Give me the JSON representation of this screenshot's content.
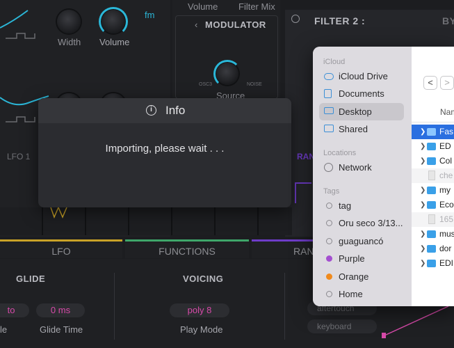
{
  "synth": {
    "fm_badge": "fm",
    "osc_labels": {
      "width": "Width",
      "volume": "Volume"
    },
    "top_labels": {
      "volume": "Volume",
      "filter_mix": "Filter Mix"
    },
    "modulator": {
      "title": "MODULATOR",
      "left": "OSC3",
      "right": "NOISE",
      "source": "Source"
    },
    "filter2": {
      "title": "FILTER 2 :",
      "bypass": "BYP"
    },
    "lfo1": "LFO 1",
    "ran_short": "RAN",
    "tabs": [
      "LFO",
      "FUNCTIONS",
      "RAN"
    ],
    "glide": {
      "title": "GLIDE",
      "mode_value": "to",
      "mode_label": "le",
      "time_value": "0 ms",
      "time_label": "Glide Time"
    },
    "voicing": {
      "title": "VOICING",
      "mode_value": "poly 8",
      "mode_label": "Play Mode"
    },
    "mod_sources": [
      "aftertouch",
      "keyboard"
    ],
    "colors": {
      "accent": "#2bb7d8",
      "pink": "#d74aa9",
      "lfo": "#c9a227",
      "functions": "#3fa66a",
      "ran": "#6e3cc8"
    }
  },
  "dialog": {
    "title": "Info",
    "icon": "info-icon",
    "message": "Importing, please wait . . ."
  },
  "finder": {
    "sidebar": {
      "icloud_header": "iCloud",
      "icloud_items": [
        {
          "label": "iCloud Drive",
          "icon": "cloud-icon"
        },
        {
          "label": "Documents",
          "icon": "document-icon"
        },
        {
          "label": "Desktop",
          "icon": "desktop-icon",
          "selected": true
        },
        {
          "label": "Shared",
          "icon": "shared-folder-icon"
        }
      ],
      "locations_header": "Locations",
      "locations_items": [
        {
          "label": "Network",
          "icon": "globe-icon"
        }
      ],
      "tags_header": "Tags",
      "tags": [
        {
          "label": "tag",
          "color": ""
        },
        {
          "label": "Oru seco 3/13...",
          "color": ""
        },
        {
          "label": "guaguancó",
          "color": ""
        },
        {
          "label": "Purple",
          "color": "#a44fd0"
        },
        {
          "label": "Orange",
          "color": "#f08a1d"
        },
        {
          "label": "Home",
          "color": ""
        }
      ]
    },
    "nav": {
      "back": "<",
      "forward": ">"
    },
    "column_header": "Nam",
    "rows": [
      {
        "name": "Fas",
        "kind": "folder",
        "selected": true
      },
      {
        "name": "ED",
        "kind": "folder"
      },
      {
        "name": "Col",
        "kind": "folder"
      },
      {
        "name": "che",
        "kind": "file",
        "dim": true
      },
      {
        "name": "my",
        "kind": "folder"
      },
      {
        "name": "Eco",
        "kind": "folder"
      },
      {
        "name": "165",
        "kind": "file",
        "dim": true
      },
      {
        "name": "mus",
        "kind": "folder"
      },
      {
        "name": "dor",
        "kind": "folder"
      },
      {
        "name": "EDI",
        "kind": "folder"
      }
    ]
  }
}
